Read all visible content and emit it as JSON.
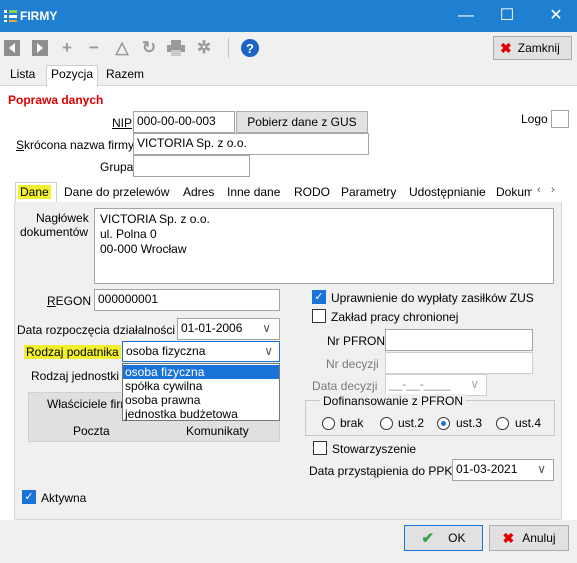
{
  "window": {
    "title": "FIRMY",
    "minimize": "—",
    "maximize": "☐",
    "close": "✕"
  },
  "toolbar": {
    "icons": [
      "first-icon",
      "last-icon",
      "add-icon",
      "remove-icon",
      "edit-icon",
      "refresh-icon",
      "print-icon",
      "settings-icon",
      "help-icon"
    ],
    "close_label": "Zamknij"
  },
  "main_tabs": [
    "Lista",
    "Pozycja",
    "Razem"
  ],
  "form": {
    "section_title": "Poprawa danych",
    "nip_label": "NIP",
    "nip_value": "000-00-00-003",
    "gus_button": "Pobierz dane z GUS",
    "logo_label": "Logo",
    "short_name_label": "Skrócona nazwa firmy",
    "short_name_value": "VICTORIA Sp. z o.o.",
    "group_label": "Grupa",
    "group_value": ""
  },
  "inner_tabs": [
    "Dane",
    "Dane do przelewów",
    "Adres",
    "Inne dane",
    "RODO",
    "Parametry",
    "Udostępnianie",
    "Dokum"
  ],
  "dane": {
    "header_label_1": "Nagłówek",
    "header_label_2": "dokumentów",
    "header_lines": [
      "VICTORIA Sp. z o.o.",
      "ul. Polna 0",
      "00-000 Wrocław"
    ],
    "regon_label": "REGON",
    "regon_value": "000000001",
    "start_date_label": "Data rozpoczęcia działalności",
    "start_date_value": "01-01-2006",
    "taxpayer_label": "Rodzaj podatnika",
    "taxpayer_value": "osoba fizyczna",
    "taxpayer_options": [
      "osoba fizyczna",
      "spółka cywilna",
      "osoba prawna",
      "jednostka budżetowa"
    ],
    "unit_type_label": "Rodzaj jednostki",
    "owners_button": "Właściciele firm",
    "mail_button": "Poczta",
    "messengers_button": "Komunikaty",
    "zus_label": "Uprawnienie do wypłaty zasiłków ZUS",
    "zus_checked": true,
    "sheltered_label": "Zakład pracy chronionej",
    "sheltered_checked": false,
    "pfron_nr_label": "Nr PFRON",
    "decision_nr_label": "Nr decyzji",
    "decision_date_label": "Data decyzji",
    "decision_date_value": "__-__-____",
    "pfron_group_label": "Dofinansowanie z PFRON",
    "pfron_options": [
      "brak",
      "ust.2",
      "ust.3",
      "ust.4"
    ],
    "pfron_selected": "ust.3",
    "association_label": "Stowarzyszenie",
    "association_checked": false,
    "ppk_label": "Data przystąpienia do PPK",
    "ppk_value": "01-03-2021",
    "active_label": "Aktywna",
    "active_checked": true
  },
  "buttons": {
    "ok": "OK",
    "cancel": "Anuluj"
  },
  "colors": {
    "titlebar": "#1f7fd0",
    "accent": "#1a73d8",
    "highlight": "#f2ef2d",
    "error_red": "#e00000"
  }
}
